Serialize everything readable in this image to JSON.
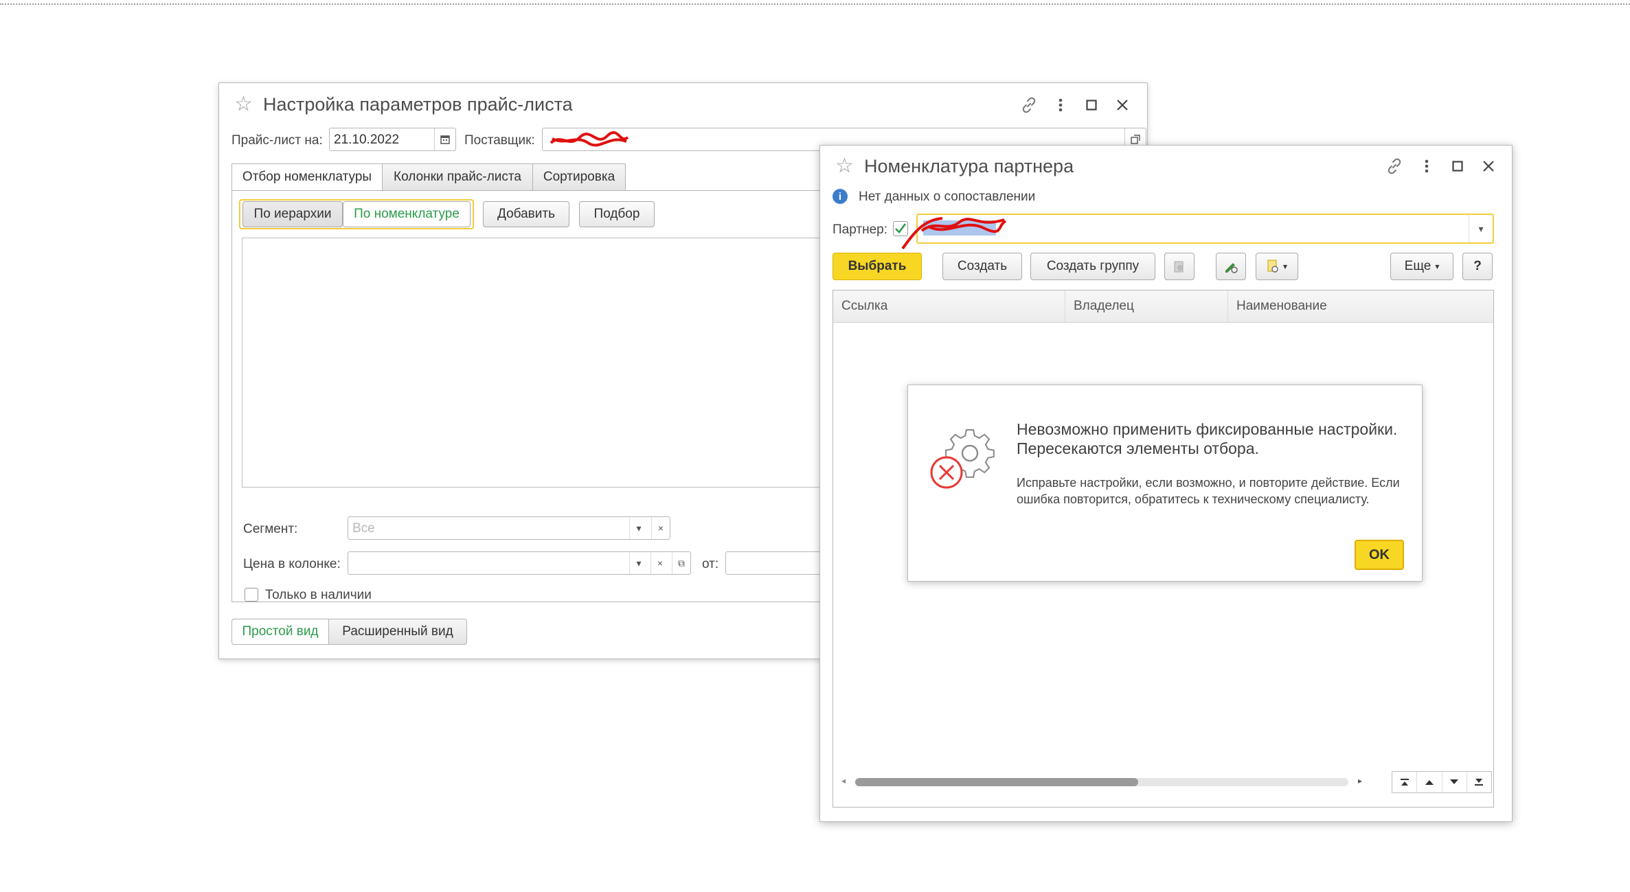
{
  "back_window": {
    "title": "Настройка параметров прайс-листа",
    "pricelist_label": "Прайс-лист на:",
    "pricelist_date": "21.10.2022",
    "supplier_label": "Поставщик:",
    "tabs": [
      {
        "label": "Отбор номенклатуры"
      },
      {
        "label": "Колонки прайс-листа"
      },
      {
        "label": "Сортировка"
      }
    ],
    "toggle": {
      "by_hierarchy": "По иерархии",
      "by_nomenclature": "По номенклатуре"
    },
    "add_label": "Добавить",
    "pick_label": "Подбор",
    "segment_label": "Сегмент:",
    "segment_placeholder": "Все",
    "price_column_label": "Цена в колонке:",
    "from_label": "от:",
    "only_available_label": "Только в наличии",
    "simple_view_label": "Простой вид",
    "extended_view_label": "Расширенный вид"
  },
  "front_window": {
    "title": "Номенклатура партнера",
    "info_text": "Нет данных о сопоставлении",
    "partner_label": "Партнер:",
    "toolbar": {
      "select_label": "Выбрать",
      "create_label": "Создать",
      "create_group_label": "Создать группу",
      "more_label": "Еще",
      "help_label": "?"
    },
    "columns": [
      "Ссылка",
      "Владелец",
      "Наименование"
    ]
  },
  "error_dialog": {
    "title": "Невозможно применить фиксированные настройки. Пересекаются элементы отбора.",
    "body": "Исправьте настройки, если возможно, и повторите действие. Если ошибка повторится, обратитесь к техническому специалисту.",
    "ok_label": "OK"
  },
  "colors": {
    "accent_yellow": "#f7d723",
    "green_text": "#2c9a4a",
    "error_red": "#e53935",
    "info_blue": "#3a7dc9"
  }
}
